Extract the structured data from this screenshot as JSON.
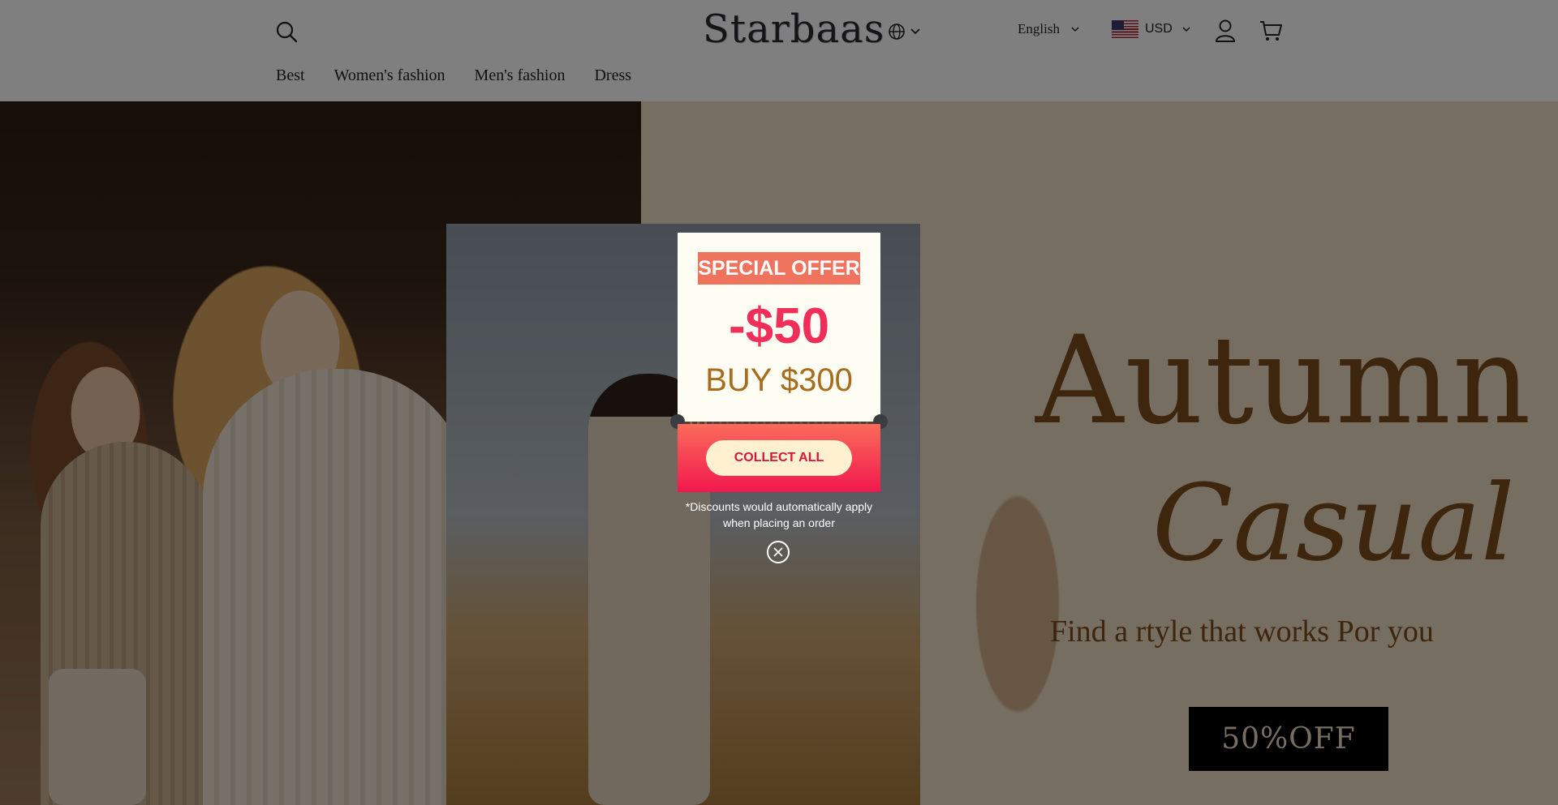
{
  "header": {
    "logo": "Starbaas",
    "language": "English",
    "currency": "USD",
    "icons": [
      "search-icon",
      "globe-icon",
      "chevron-down-icon",
      "us-flag-icon",
      "account-icon",
      "cart-icon"
    ]
  },
  "nav": {
    "items": [
      {
        "label": "Best"
      },
      {
        "label": "Women's fashion"
      },
      {
        "label": "Men's fashion"
      },
      {
        "label": "Dress"
      }
    ]
  },
  "hero": {
    "headline_1": "Autumn",
    "headline_2": "Casual",
    "tagline": "Find a rtyle that works Por you",
    "cta": "50%OFF"
  },
  "popup": {
    "badge": "SPECIAL OFFER",
    "amount": "-$50",
    "condition": "BUY $300",
    "collect_label": "COLLECT ALL",
    "note": "*Discounts would automatically apply when placing an order"
  },
  "colors": {
    "accent_red": "#ef2e5a",
    "badge_orange": "#f0735e",
    "hero_text": "#7a4a1c",
    "cta_bg": "#000000"
  }
}
